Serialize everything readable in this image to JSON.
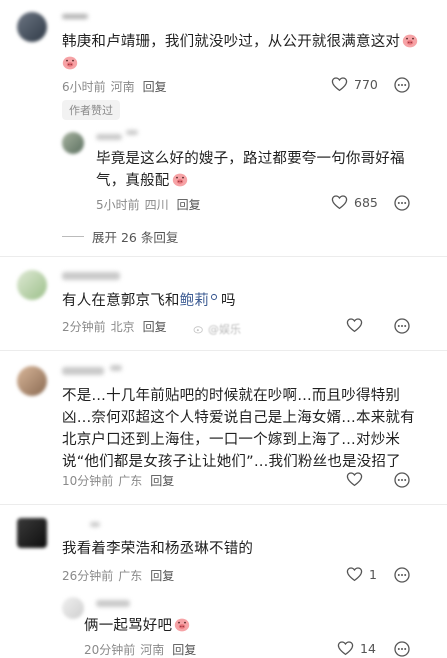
{
  "comments": [
    {
      "text": "韩庚和卢靖珊，我们就没吵过，从公开就很满意这对",
      "time": "6小时前",
      "location": "河南",
      "reply": "回复",
      "likes": "770",
      "badge": "作者赞过"
    },
    {
      "text": "毕竟是这么好的嫂子，路过都要夸一句你哥好福气，真般配",
      "time": "5小时前",
      "location": "四川",
      "reply": "回复",
      "likes": "685"
    },
    {
      "text_before": "有人在意郭京飞和",
      "mention": "鲍莉",
      "text_after": "吗",
      "time": "2分钟前",
      "location": "北京",
      "reply": "回复",
      "likes": ""
    },
    {
      "text": "不是…十几年前贴吧的时候就在吵啊…而且吵得特别凶…奈何邓超这个人特爱说自己是上海女婿…本来就有北京户口还到上海住，一口一个嫁到上海了…对炒米说“他们都是女孩子让让她们”…我们粉丝也是没招了",
      "time": "10分钟前",
      "location": "广东",
      "reply": "回复",
      "likes": ""
    },
    {
      "text": "我看着李荣浩和杨丞琳不错的",
      "time": "26分钟前",
      "location": "广东",
      "reply": "回复",
      "likes": "1"
    },
    {
      "text": "俩一起骂好吧",
      "time": "20分钟前",
      "location": "河南",
      "reply": "回复",
      "likes": "14"
    }
  ],
  "expand_replies": "展开 26 条回复",
  "watermark": "@娱乐",
  "icons": {
    "like": "heart-outline-icon",
    "more": "more-dots-circle-icon",
    "emoji": "pig-face-emoji-icon",
    "mention": "mention-tag-icon"
  },
  "colors": {
    "mention": "#3d5c93",
    "meta": "#8a8a8a",
    "divider": "#ececec"
  }
}
